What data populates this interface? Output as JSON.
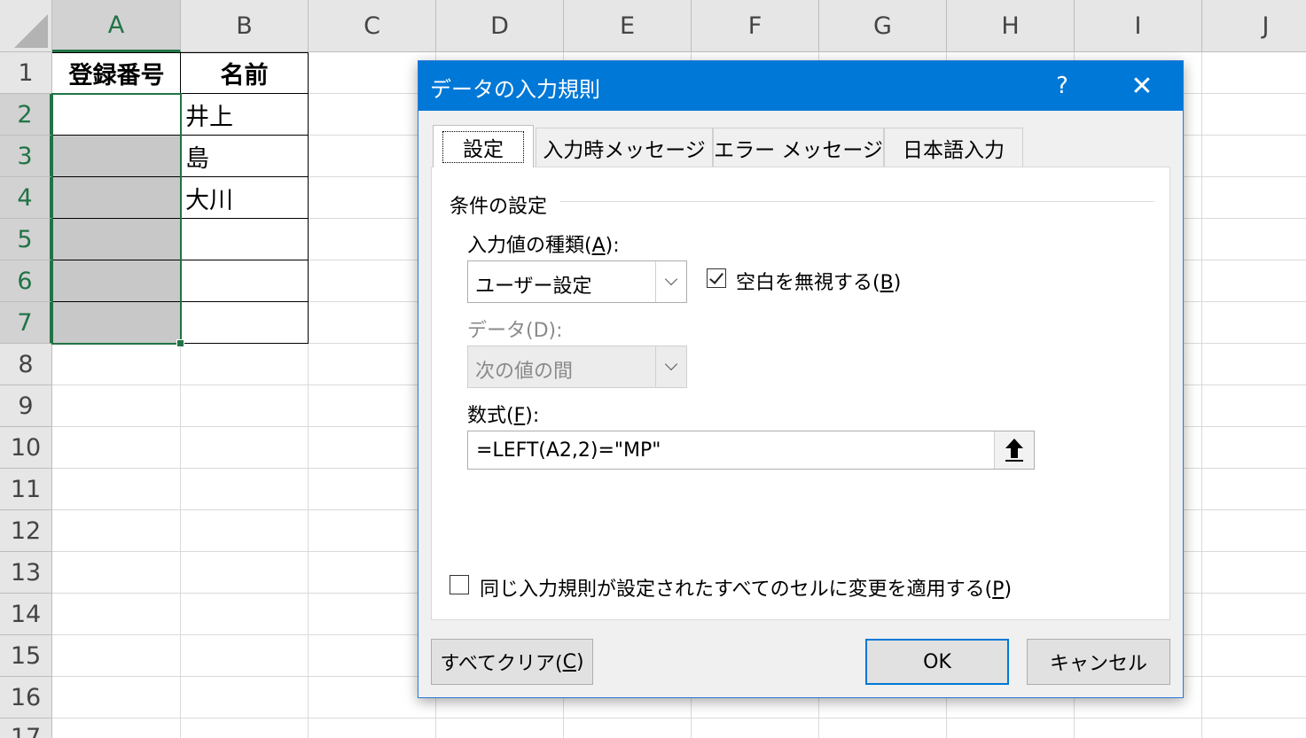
{
  "spreadsheet": {
    "columns": [
      "A",
      "B",
      "C",
      "D",
      "E",
      "F",
      "G",
      "H",
      "I",
      "J"
    ],
    "rows": [
      "1",
      "2",
      "3",
      "4",
      "5",
      "6",
      "7",
      "8",
      "9",
      "10",
      "11",
      "12",
      "13",
      "14",
      "15",
      "16",
      "17"
    ],
    "cells": {
      "A1": "登録番号",
      "B1": "名前",
      "B2": "井上",
      "B3": "島",
      "B4": "大川"
    },
    "selected_column": "A",
    "selected_rows": "2-7"
  },
  "dialog": {
    "title": "データの入力規則",
    "help_label": "?",
    "close_label": "✕",
    "tabs": [
      {
        "label": "設定",
        "active": true
      },
      {
        "label": "入力時メッセージ",
        "active": false
      },
      {
        "label": "エラー メッセージ",
        "active": false
      },
      {
        "label": "日本語入力",
        "active": false
      }
    ],
    "settings": {
      "group_title": "条件の設定",
      "allow_label": "入力値の種類(",
      "allow_key": "A",
      "allow_suffix": "):",
      "allow_value": "ユーザー設定",
      "ignore_blank_label": "空白を無視する(",
      "ignore_blank_key": "B",
      "ignore_blank_suffix": ")",
      "ignore_blank_checked": true,
      "data_label": "データ(D):",
      "data_value": "次の値の間",
      "formula_label": "数式(",
      "formula_key": "F",
      "formula_suffix": "):",
      "formula_value": "=LEFT(A2,2)=\"MP\"",
      "apply_all_label": "同じ入力規則が設定されたすべてのセルに変更を適用する(",
      "apply_all_key": "P",
      "apply_all_suffix": ")",
      "apply_all_checked": false
    },
    "buttons": {
      "clear_all_label": "すべてクリア(",
      "clear_all_key": "C",
      "clear_all_suffix": ")",
      "ok_label": "OK",
      "cancel_label": "キャンセル"
    }
  },
  "colors": {
    "titlebar": "#0078d7",
    "excel_green": "#217346",
    "selection_fill": "#c8c8c8"
  },
  "icons": {
    "select_all": "select-all-triangle-icon",
    "dropdown": "chevron-down-icon",
    "checkbox": "check-icon",
    "range_ref": "arrow-up-icon",
    "help": "question-icon",
    "close": "close-icon"
  }
}
